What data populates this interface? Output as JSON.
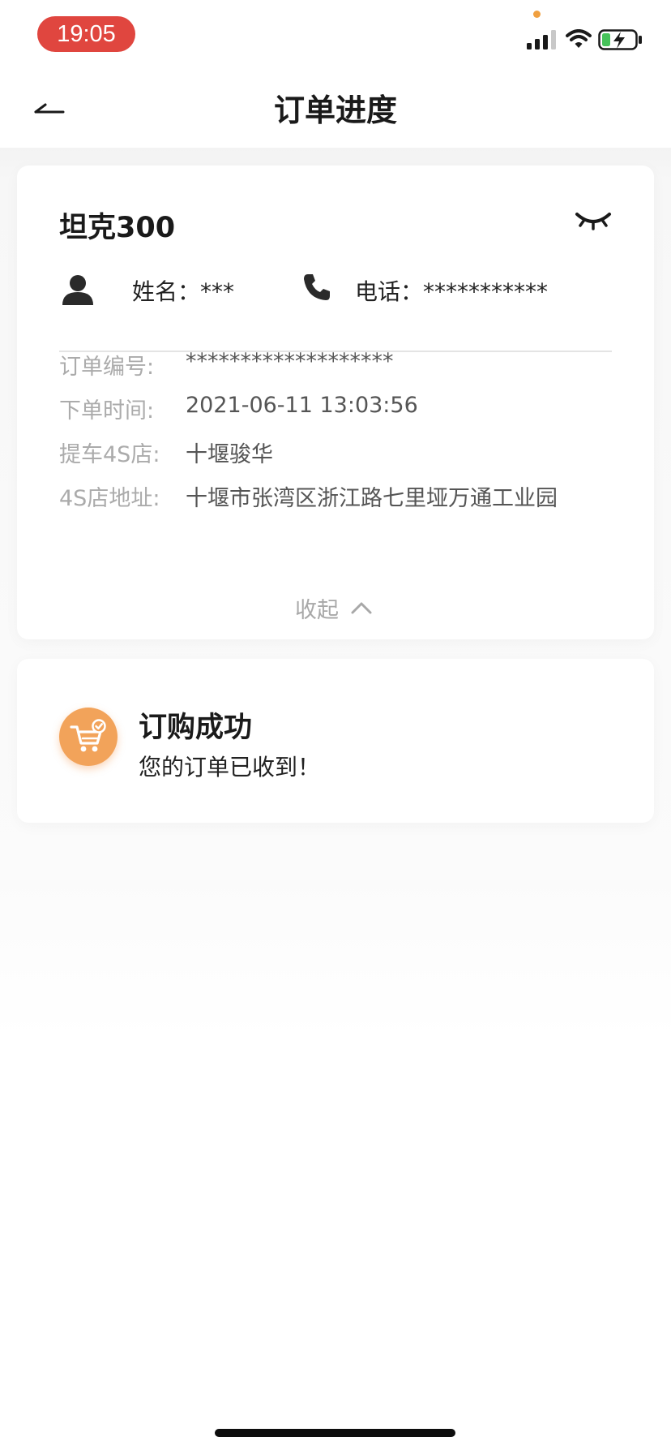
{
  "status_bar": {
    "time": "19:05",
    "signal_icon": "cellular-signal-icon",
    "wifi_icon": "wifi-icon",
    "battery_icon": "battery-charging-icon",
    "time_pill_color": "#e0463f"
  },
  "nav": {
    "title": "订单进度",
    "back_icon": "back-arrow-icon"
  },
  "order": {
    "car_name": "坦克300",
    "visibility_icon": "eye-closed-icon",
    "name_text": "姓名：***",
    "phone_text": "电话：***********",
    "details": [
      {
        "label": "订单编号:",
        "value": "*******************"
      },
      {
        "label": "下单时间:",
        "value": "2021-06-11 13:03:56"
      },
      {
        "label": "提车4S店:",
        "value": "十堰骏华"
      },
      {
        "label": "4S店地址:",
        "value": "十堰市张湾区浙江路七里垭万通工业园"
      }
    ],
    "collapse_label": "收起"
  },
  "status": {
    "title": "订购成功",
    "subtitle": "您的订单已收到！",
    "icon": "cart-check-icon",
    "accent_color": "#f2a35a"
  }
}
